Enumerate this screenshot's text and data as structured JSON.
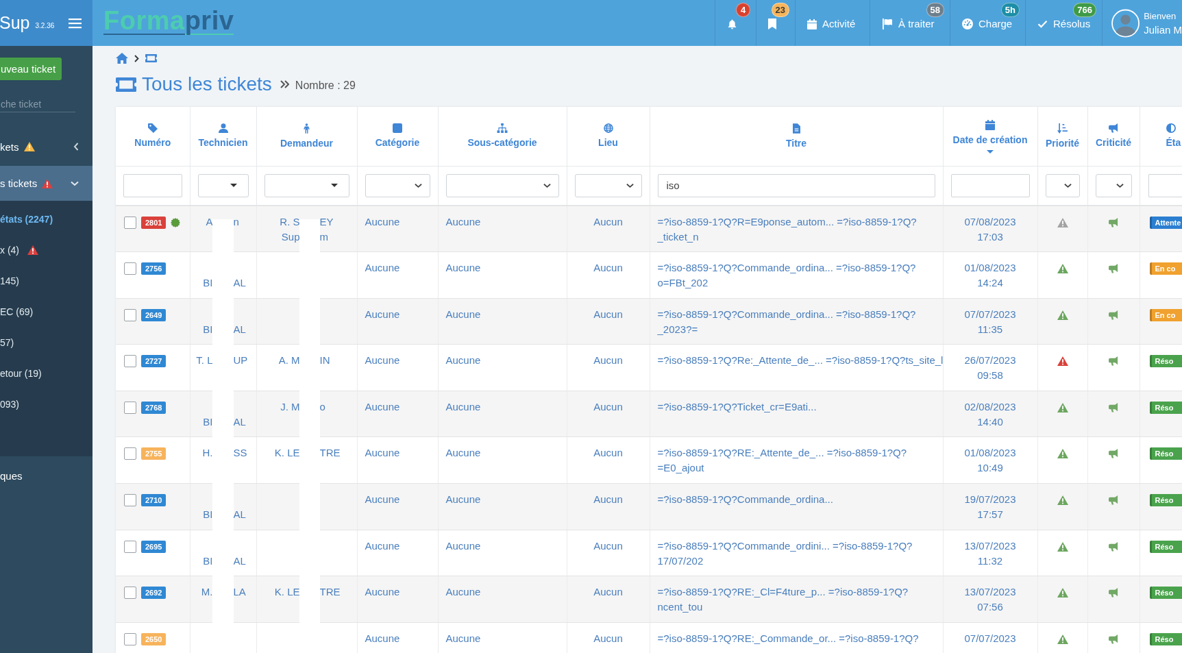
{
  "sidebar": {
    "brand": "Sup",
    "version": "3.2.36",
    "new_ticket_button": "uveau ticket",
    "search": {
      "placeholder": "che ticket"
    },
    "menu": [
      {
        "label": "kets",
        "alert": {
          "color": "#f5b642"
        },
        "expanded": false
      },
      {
        "label": "s tickets",
        "alert": {
          "color": "#dc3f3f"
        },
        "expanded": true,
        "children": [
          {
            "label": "états (2247)",
            "selected": true
          },
          {
            "label": "x (4)",
            "alert": {
              "color": "#dc3f3f"
            },
            "selected": false
          },
          {
            "label": "145)",
            "selected": false
          },
          {
            "label": "EC (69)",
            "selected": false
          },
          {
            "label": "57)",
            "selected": false
          },
          {
            "label": "etour (19)",
            "selected": false
          },
          {
            "label": "093)",
            "selected": false
          }
        ]
      },
      {
        "label": "ques"
      }
    ]
  },
  "topbar": {
    "logo": {
      "part_1": "Forma",
      "part_2": "priv"
    },
    "items": [
      {
        "badge": {
          "text": "4",
          "color": "#d9412f"
        }
      },
      {
        "badge": {
          "text": "23",
          "color": "#f7b55c"
        }
      },
      {
        "label": "Activité"
      },
      {
        "label": "À traiter",
        "badge": {
          "text": "58",
          "color": "#6d7f8d"
        }
      },
      {
        "label": "Charge",
        "badge": {
          "text": "5h",
          "color": "#1c8ea7"
        }
      },
      {
        "label": "Résolus",
        "badge": {
          "text": "766",
          "color": "#3f9a48"
        }
      }
    ],
    "user": {
      "greeting": "Bienven",
      "name": "Julian M"
    }
  },
  "page": {
    "title": "Tous les tickets",
    "count": "Nombre : 29"
  },
  "table": {
    "columns": [
      {
        "label": "Numéro",
        "sorted": false,
        "filter": {
          "kind": "text"
        }
      },
      {
        "label": "Technicien",
        "sorted": false,
        "filter": {
          "kind": "combo"
        }
      },
      {
        "label": "Demandeur",
        "sorted": false,
        "filter": {
          "kind": "combo"
        }
      },
      {
        "label": "Catégorie",
        "sorted": false,
        "filter": {
          "kind": "select"
        }
      },
      {
        "label": "Sous-catégorie",
        "sorted": false,
        "filter": {
          "kind": "select"
        }
      },
      {
        "label": "Lieu",
        "sorted": false,
        "filter": {
          "kind": "select"
        }
      },
      {
        "label": "Titre",
        "sorted": false,
        "filter": {
          "kind": "text",
          "value": "iso"
        }
      },
      {
        "label": "Date de création",
        "sorted": true,
        "filter": {
          "kind": "text"
        }
      },
      {
        "label": "Priorité",
        "sorted": false,
        "filter": {
          "kind": "select"
        }
      },
      {
        "label": "Criticité",
        "sorted": false,
        "filter": {
          "kind": "select"
        }
      },
      {
        "label": "Éta",
        "sorted": false,
        "filter": {
          "kind": "text"
        }
      }
    ],
    "rows": [
      {
        "checked": false,
        "number": {
          "text": "2801",
          "color": "#d9413a"
        },
        "new_marker": true,
        "technician": {
          "lines": [
            {
              "before": "A",
              "after": "n"
            }
          ]
        },
        "requester": {
          "lines": [
            {
              "before": "R. S",
              "after": "EY"
            },
            {
              "before": "Sup",
              "after": "m"
            }
          ]
        },
        "category": "Aucune",
        "subcategory": "Aucune",
        "location": "Aucun",
        "title_lines": [
          "=?iso-8859-1?Q?R=E9ponse_autom... =?iso-8859-1?Q?",
          "_ticket_n"
        ],
        "date": "07/08/2023",
        "time": "17:03",
        "priority": {
          "color": "#a3a3a3"
        },
        "state": {
          "text": "Attente",
          "color": "#2b7fd1"
        }
      },
      {
        "checked": false,
        "number": {
          "text": "2756",
          "color": "#2f88d3"
        },
        "new_marker": false,
        "technician": {
          "first_line_hidden": true,
          "lines": [
            {
              "before": "BI",
              "after": "AL"
            }
          ]
        },
        "category": "Aucune",
        "subcategory": "Aucune",
        "location": "Aucun",
        "title_lines": [
          "=?iso-8859-1?Q?Commande_ordina... =?iso-8859-1?Q?",
          "o=FBt_202"
        ],
        "date": "01/08/2023",
        "time": "14:24",
        "priority": {
          "color": "#6ca65f"
        },
        "state": {
          "text": "En co",
          "color": "#f0a12f"
        }
      },
      {
        "checked": false,
        "number": {
          "text": "2649",
          "color": "#2f88d3"
        },
        "new_marker": false,
        "technician": {
          "first_line_hidden": true,
          "lines": [
            {
              "before": "BI",
              "after": "AL"
            }
          ]
        },
        "category": "Aucune",
        "subcategory": "Aucune",
        "location": "Aucun",
        "title_lines": [
          "=?iso-8859-1?Q?Commande_ordina... =?iso-8859-1?Q?",
          "_2023?="
        ],
        "date": "07/07/2023",
        "time": "11:35",
        "priority": {
          "color": "#6ca65f"
        },
        "state": {
          "text": "En co",
          "color": "#f0a12f"
        }
      },
      {
        "checked": false,
        "number": {
          "text": "2727",
          "color": "#2f88d3"
        },
        "new_marker": false,
        "technician": {
          "lines": [
            {
              "before": "T. L",
              "after": "UP"
            }
          ]
        },
        "requester": {
          "lines": [
            {
              "before": "A. M",
              "after": "IN"
            }
          ]
        },
        "category": "Aucune",
        "subcategory": "Aucune",
        "location": "Aucun",
        "title_lines": [
          "=?iso-8859-1?Q?Re:_Attente_de_... =?iso-8859-1?Q?ts_site_l"
        ],
        "date": "26/07/2023",
        "time": "09:58",
        "priority": {
          "color": "#d9413a"
        },
        "state": {
          "text": "Réso",
          "color": "#4aa34c"
        }
      },
      {
        "checked": false,
        "number": {
          "text": "2768",
          "color": "#2f88d3"
        },
        "new_marker": false,
        "technician": {
          "first_line_hidden": true,
          "lines": [
            {
              "before": "BI",
              "after": "AL"
            }
          ]
        },
        "requester": {
          "lines": [
            {
              "before": "J. M",
              "after": "o"
            }
          ]
        },
        "category": "Aucune",
        "subcategory": "Aucune",
        "location": "Aucun",
        "title_lines": [
          "=?iso-8859-1?Q?Ticket_cr=E9ati..."
        ],
        "date": "02/08/2023",
        "time": "14:40",
        "priority": {
          "color": "#6ca65f"
        },
        "state": {
          "text": "Réso",
          "color": "#4aa34c"
        }
      },
      {
        "checked": false,
        "number": {
          "text": "2755",
          "color": "#f7b35b"
        },
        "new_marker": false,
        "technician": {
          "lines": [
            {
              "before": "H.",
              "after": "SS"
            }
          ]
        },
        "requester": {
          "lines": [
            {
              "before": "K. LE",
              "after": "TRE"
            }
          ]
        },
        "category": "Aucune",
        "subcategory": "Aucune",
        "location": "Aucun",
        "title_lines": [
          "=?iso-8859-1?Q?RE:_Attente_de_... =?iso-8859-1?Q?",
          "=E0_ajout"
        ],
        "date": "01/08/2023",
        "time": "10:49",
        "priority": {
          "color": "#6ca65f"
        },
        "state": {
          "text": "Réso",
          "color": "#4aa34c"
        }
      },
      {
        "checked": false,
        "number": {
          "text": "2710",
          "color": "#2f88d3"
        },
        "new_marker": false,
        "technician": {
          "first_line_hidden": true,
          "lines": [
            {
              "before": "BI",
              "after": "AL"
            }
          ]
        },
        "category": "Aucune",
        "subcategory": "Aucune",
        "location": "Aucun",
        "title_lines": [
          "=?iso-8859-1?Q?Commande_ordina..."
        ],
        "date": "19/07/2023",
        "time": "17:57",
        "priority": {
          "color": "#6ca65f"
        },
        "state": {
          "text": "Réso",
          "color": "#4aa34c"
        }
      },
      {
        "checked": false,
        "number": {
          "text": "2695",
          "color": "#2f88d3"
        },
        "new_marker": false,
        "technician": {
          "first_line_hidden": true,
          "lines": [
            {
              "before": "BI",
              "after": "AL"
            }
          ]
        },
        "category": "Aucune",
        "subcategory": "Aucune",
        "location": "Aucun",
        "title_lines": [
          "=?iso-8859-1?Q?Commande_ordini... =?iso-8859-1?Q?",
          "17/07/202"
        ],
        "date": "13/07/2023",
        "time": "11:32",
        "priority": {
          "color": "#6ca65f"
        },
        "state": {
          "text": "Réso",
          "color": "#4aa34c"
        }
      },
      {
        "checked": false,
        "number": {
          "text": "2692",
          "color": "#2f88d3"
        },
        "new_marker": false,
        "technician": {
          "lines": [
            {
              "before": "M.",
              "after": "LA"
            }
          ]
        },
        "requester": {
          "lines": [
            {
              "before": "K. LE",
              "after": "TRE"
            }
          ]
        },
        "category": "Aucune",
        "subcategory": "Aucune",
        "location": "Aucun",
        "title_lines": [
          "=?iso-8859-1?Q?RE:_Cl=F4ture_p... =?iso-8859-1?Q?",
          "ncent_tou"
        ],
        "date": "13/07/2023",
        "time": "07:56",
        "priority": {
          "color": "#6ca65f"
        },
        "state": {
          "text": "Réso",
          "color": "#4aa34c"
        }
      },
      {
        "checked": false,
        "number": {
          "text": "2650",
          "color": "#f7b35b"
        },
        "new_marker": false,
        "category": "Aucune",
        "subcategory": "Aucune",
        "location": "Aucun",
        "title_lines": [
          "=?iso-8859-1?Q?RE:_Commande_or... =?iso-8859-1?Q?"
        ],
        "date": "07/07/2023",
        "priority": {
          "color": "#6ca65f"
        },
        "state": {
          "text": "Réso",
          "color": "#4aa34c"
        }
      }
    ]
  }
}
